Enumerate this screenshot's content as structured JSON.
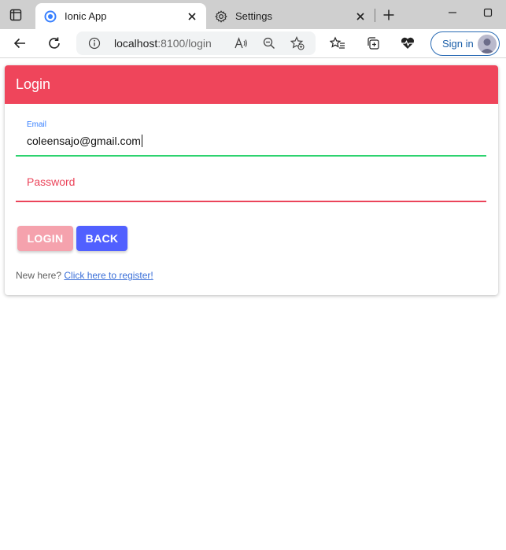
{
  "browser": {
    "tabs": [
      {
        "title": "Ionic App",
        "active": true
      },
      {
        "title": "Settings",
        "active": false
      }
    ],
    "url_host": "localhost",
    "url_path": ":8100/login",
    "signin_label": "Sign in"
  },
  "page": {
    "header_title": "Login",
    "email_label": "Email",
    "email_value": "coleensajo@gmail.com",
    "password_label": "Password",
    "login_label": "LOGIN",
    "back_label": "BACK",
    "register_prefix": "New here? ",
    "register_link": "Click here to register!"
  },
  "colors": {
    "primary_header": "#ef455b",
    "valid_field": "#2dd36f",
    "invalid_field": "#eb445a",
    "back_button": "#5160ff"
  }
}
